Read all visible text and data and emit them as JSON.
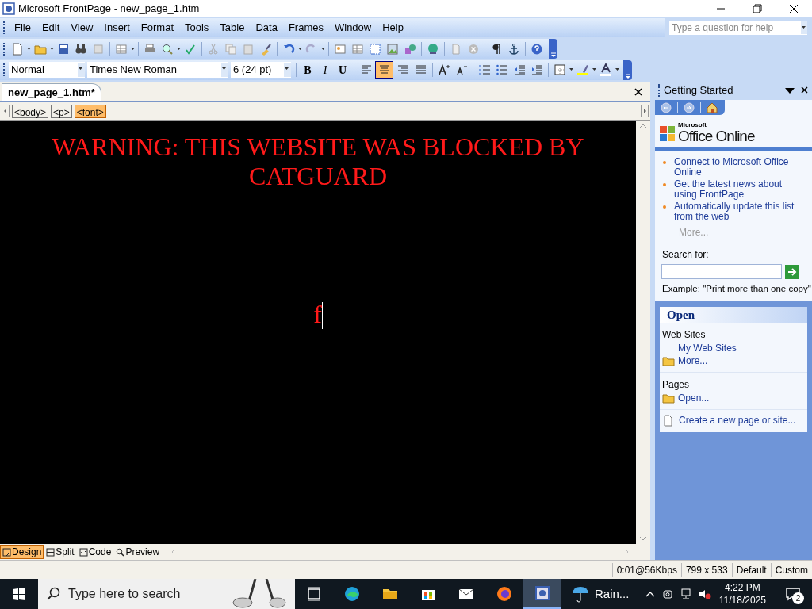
{
  "window": {
    "title": "Microsoft FrontPage - new_page_1.htm"
  },
  "menu": [
    "File",
    "Edit",
    "View",
    "Insert",
    "Format",
    "Tools",
    "Table",
    "Data",
    "Frames",
    "Window",
    "Help"
  ],
  "help_search": {
    "placeholder": "Type a question for help"
  },
  "formatting": {
    "style": "Normal",
    "font": "Times New Roman",
    "size": "6  (24 pt)",
    "bold": "B",
    "italic": "I",
    "underline": "U",
    "alignment": [
      {
        "selected": false
      },
      {
        "selected": true
      },
      {
        "selected": false
      },
      {
        "selected": false
      }
    ]
  },
  "document_tab": {
    "label": "new_page_1.htm*"
  },
  "tag_selector": [
    {
      "label": "<body>",
      "selected": false
    },
    {
      "label": "<p>",
      "selected": false
    },
    {
      "label": "<font>",
      "selected": true
    }
  ],
  "editor": {
    "paragraphs": [
      "WARNING: THIS WEBSITE WAS BLOCKED BY CATGUARD",
      "f"
    ]
  },
  "view_tabs": [
    {
      "label": "Design",
      "kind": "design",
      "selected": true
    },
    {
      "label": "Split",
      "kind": "split",
      "selected": false
    },
    {
      "label": "Code",
      "kind": "code",
      "selected": false
    },
    {
      "label": "Preview",
      "kind": "preview",
      "selected": false
    }
  ],
  "status_bar": [
    "0:01@56Kbps",
    "799 x 533",
    "Default",
    "Custom"
  ],
  "task_pane": {
    "title": "Getting Started",
    "brand_small": "Microsoft",
    "brand": "Office Online",
    "links": [
      "Connect to Microsoft Office Online",
      "Get the latest news about using FrontPage",
      "Automatically update this list from the web"
    ],
    "more": "More...",
    "search_label": "Search for:",
    "example": "Example:  \"Print more than one copy\"",
    "open_title": "Open",
    "groups": [
      {
        "heading": "Web Sites",
        "items": [
          {
            "label": "My Web Sites",
            "kind": "plain"
          },
          {
            "label": "More...",
            "kind": "folder"
          }
        ]
      },
      {
        "heading": "Pages",
        "items": [
          {
            "label": "Open...",
            "kind": "folder"
          }
        ]
      }
    ],
    "create": "Create a new page or site..."
  },
  "taskbar": {
    "search_placeholder": "Type here to search",
    "apps": [
      {
        "kind": "task-view",
        "selected": false
      },
      {
        "kind": "browser",
        "selected": false
      },
      {
        "kind": "folder",
        "selected": false
      },
      {
        "kind": "store",
        "selected": false
      },
      {
        "kind": "mail",
        "selected": false
      },
      {
        "kind": "fox",
        "selected": false
      },
      {
        "kind": "frontpage",
        "selected": true
      }
    ],
    "weather": "Rain...",
    "time": "4:22 PM",
    "date": "11/18/2025",
    "notifications": "2"
  }
}
